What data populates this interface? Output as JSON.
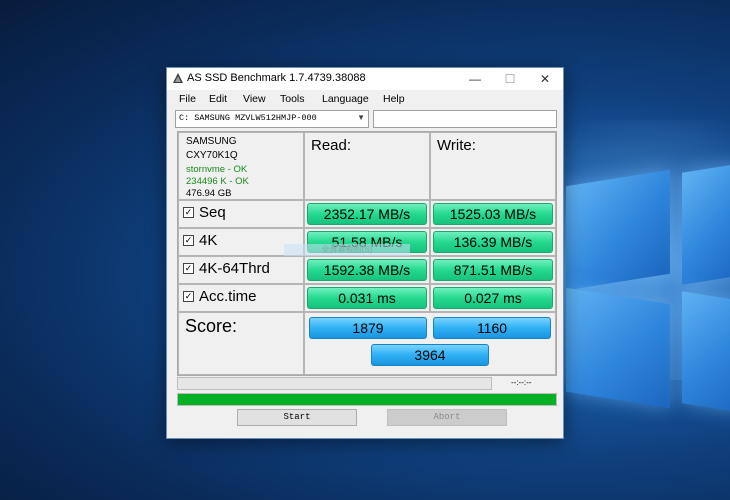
{
  "window": {
    "title": "AS SSD Benchmark 1.7.4739.38088",
    "controls": {
      "minimize": "—",
      "maximize": "☐",
      "close": "✕"
    }
  },
  "menu": [
    "File",
    "Edit",
    "View",
    "Tools",
    "Language",
    "Help"
  ],
  "drive": {
    "selected": "C: SAMSUNG MZVLW512HMJP-000",
    "test_value": ""
  },
  "info": {
    "vendor": "SAMSUNG",
    "firmware": "CXY70K1Q",
    "driver": "stornvme - OK",
    "alignment": "234496 K - OK",
    "size": "476.94 GB"
  },
  "headers": {
    "read": "Read:",
    "write": "Write:",
    "score": "Score:"
  },
  "overlay_text": "全屏幕截图(S)",
  "rows": [
    {
      "label": "Seq",
      "read": "2352.17 MB/s",
      "write": "1525.03 MB/s"
    },
    {
      "label": "4K",
      "read": "51.58 MB/s",
      "write": "136.39 MB/s"
    },
    {
      "label": "4K-64Thrd",
      "read": "1592.38 MB/s",
      "write": "871.51 MB/s"
    },
    {
      "label": "Acc.time",
      "read": "0.031 ms",
      "write": "0.027 ms"
    }
  ],
  "score": {
    "read": "1879",
    "write": "1160",
    "total": "3964"
  },
  "progress": {
    "time": "--:--:--",
    "complete_fraction": 1.0
  },
  "buttons": {
    "start": "Start",
    "abort": "Abort"
  },
  "colors": {
    "result_green": "#25d98f",
    "score_blue": "#2fb0f4",
    "progress_green": "#06b025"
  }
}
